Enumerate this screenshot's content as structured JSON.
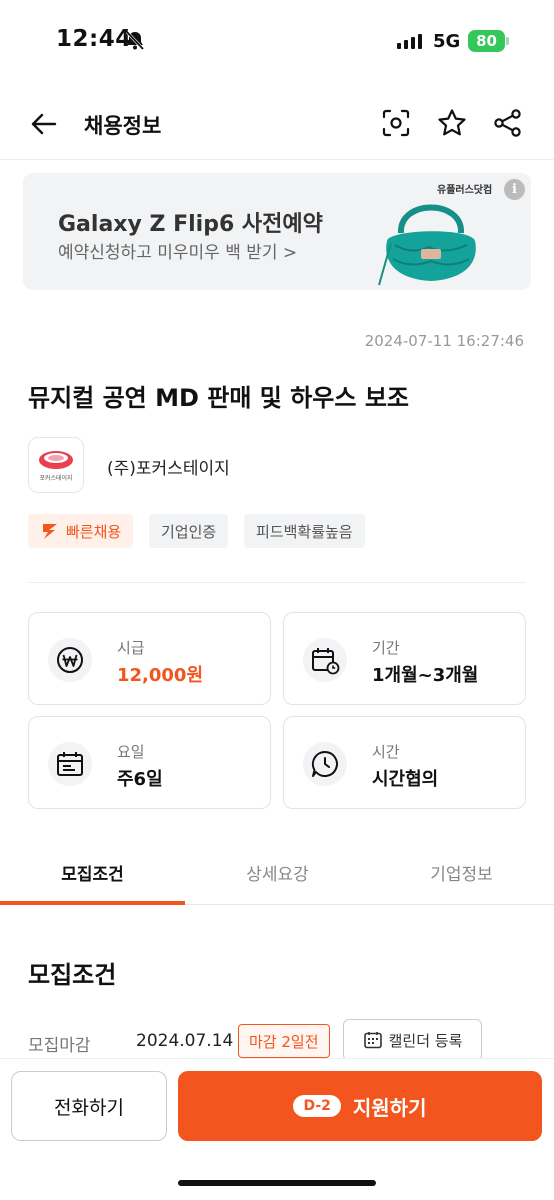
{
  "status_bar": {
    "time": "12:44",
    "network": "5G",
    "battery": "80"
  },
  "header": {
    "title": "채용정보",
    "icons": [
      "back-arrow-icon",
      "scan-icon",
      "star-icon",
      "share-icon"
    ]
  },
  "ad": {
    "brand": "유플러스닷컴",
    "title": "Galaxy Z Flip6 사전예약",
    "subtitle": "예약신청하고 미우미우 백 받기 >",
    "info": "i"
  },
  "post": {
    "datetime": "2024-07-11 16:27:46",
    "title": "뮤지컬 공연 MD 판매 및 하우스 보조",
    "company": {
      "name": "(주)포커스테이지",
      "logo_text": "포커스테이지"
    },
    "badges": {
      "fast": "빠른채용",
      "verified": "기업인증",
      "feedback": "피드백확률높음"
    }
  },
  "summary": {
    "wage": {
      "label": "시급",
      "value": "12,000원"
    },
    "period": {
      "label": "기간",
      "value": "1개월~3개월"
    },
    "days": {
      "label": "요일",
      "value": "주6일"
    },
    "hours": {
      "label": "시간",
      "value": "시간협의"
    }
  },
  "tabs": {
    "conditions": "모집조건",
    "details": "상세요강",
    "company": "기업정보"
  },
  "conditions": {
    "section_title": "모집조건",
    "deadline_label": "모집마감",
    "deadline_value": "2024.07.14",
    "deadline_badge": "마감 2일전",
    "calendar_button": "캘린더 등록"
  },
  "actions": {
    "call": "전화하기",
    "dday": "D-2",
    "apply": "지원하기"
  },
  "colors": {
    "accent": "#f2551d",
    "battery": "#34c759"
  }
}
